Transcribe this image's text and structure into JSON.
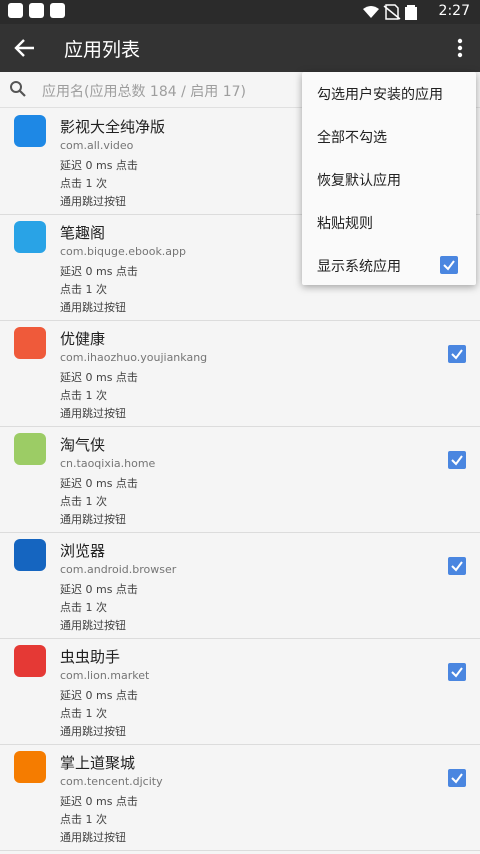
{
  "status_bar": {
    "time": "2:27"
  },
  "app_bar": {
    "title": "应用列表"
  },
  "search": {
    "placeholder": "应用名(应用总数 184 / 启用 17)"
  },
  "apps": [
    {
      "name": "影视大全纯净版",
      "package": "com.all.video",
      "delay": "延迟 0 ms 点击",
      "clicks": "点击 1 次",
      "rule": "通用跳过按钮",
      "checked": true,
      "icon": "yingshi-app-icon",
      "icon_color": "#1e88e5"
    },
    {
      "name": "笔趣阁",
      "package": "com.biquge.ebook.app",
      "delay": "延迟 0 ms 点击",
      "clicks": "点击 1 次",
      "rule": "通用跳过按钮",
      "checked": true,
      "icon": "biquge-app-icon",
      "icon_color": "#29a3e6"
    },
    {
      "name": "优健康",
      "package": "com.ihaozhuo.youjiankang",
      "delay": "延迟 0 ms 点击",
      "clicks": "点击 1 次",
      "rule": "通用跳过按钮",
      "checked": true,
      "icon": "youjiankang-app-icon",
      "icon_color": "#ef5a3a"
    },
    {
      "name": "淘气侠",
      "package": "cn.taoqixia.home",
      "delay": "延迟 0 ms 点击",
      "clicks": "点击 1 次",
      "rule": "通用跳过按钮",
      "checked": true,
      "icon": "taoqixia-app-icon",
      "icon_color": "#9ccc65"
    },
    {
      "name": "浏览器",
      "package": "com.android.browser",
      "delay": "延迟 0 ms 点击",
      "clicks": "点击 1 次",
      "rule": "通用跳过按钮",
      "checked": true,
      "icon": "browser-app-icon",
      "icon_color": "#1565c0"
    },
    {
      "name": "虫虫助手",
      "package": "com.lion.market",
      "delay": "延迟 0 ms 点击",
      "clicks": "点击 1 次",
      "rule": "通用跳过按钮",
      "checked": true,
      "icon": "chongchong-app-icon",
      "icon_color": "#e53935"
    },
    {
      "name": "掌上道聚城",
      "package": "com.tencent.djcity",
      "delay": "延迟 0 ms 点击",
      "clicks": "点击 1 次",
      "rule": "通用跳过按钮",
      "checked": true,
      "icon": "djcity-app-icon",
      "icon_color": "#f57c00"
    }
  ],
  "menu": {
    "items": [
      "勾选用户安装的应用",
      "全部不勾选",
      "恢复默认应用",
      "粘贴规则",
      "显示系统应用"
    ],
    "show_system_checked": true
  },
  "colors": {
    "toolbar": "#333333",
    "accent": "#4a86e0",
    "background": "#f5f5f5"
  }
}
